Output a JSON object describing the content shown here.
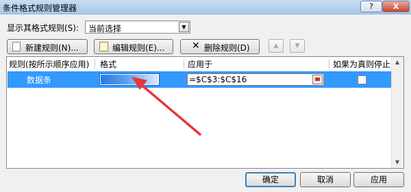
{
  "window": {
    "title": "条件格式规则管理器",
    "help_glyph": "?",
    "close_glyph": "X"
  },
  "scope": {
    "label": "显示其格式规则(S):",
    "value": "当前选择",
    "arrow_glyph": "▼"
  },
  "toolbar": {
    "new_label": "新建规则(N)...",
    "edit_label": "编辑规则(E)...",
    "delete_label": "删除规则(D)",
    "delete_glyph": "✕",
    "up_glyph": "▲",
    "down_glyph": "▼"
  },
  "list": {
    "headers": [
      "规则(按所示顺序应用)",
      "格式",
      "应用于",
      "如果为真则停止"
    ],
    "rows": [
      {
        "rule": "数据条",
        "applies_to": "=$C$3:$C$16",
        "stop_if_true": false,
        "selected": true
      }
    ],
    "scroll_up_glyph": "▲",
    "scroll_down_glyph": "▼"
  },
  "buttons": {
    "ok": "确定",
    "cancel": "取消",
    "apply": "应用"
  },
  "colors": {
    "selection": "#3399ff",
    "databar": "#2a79e8",
    "annotation_arrow": "#e8363a"
  }
}
